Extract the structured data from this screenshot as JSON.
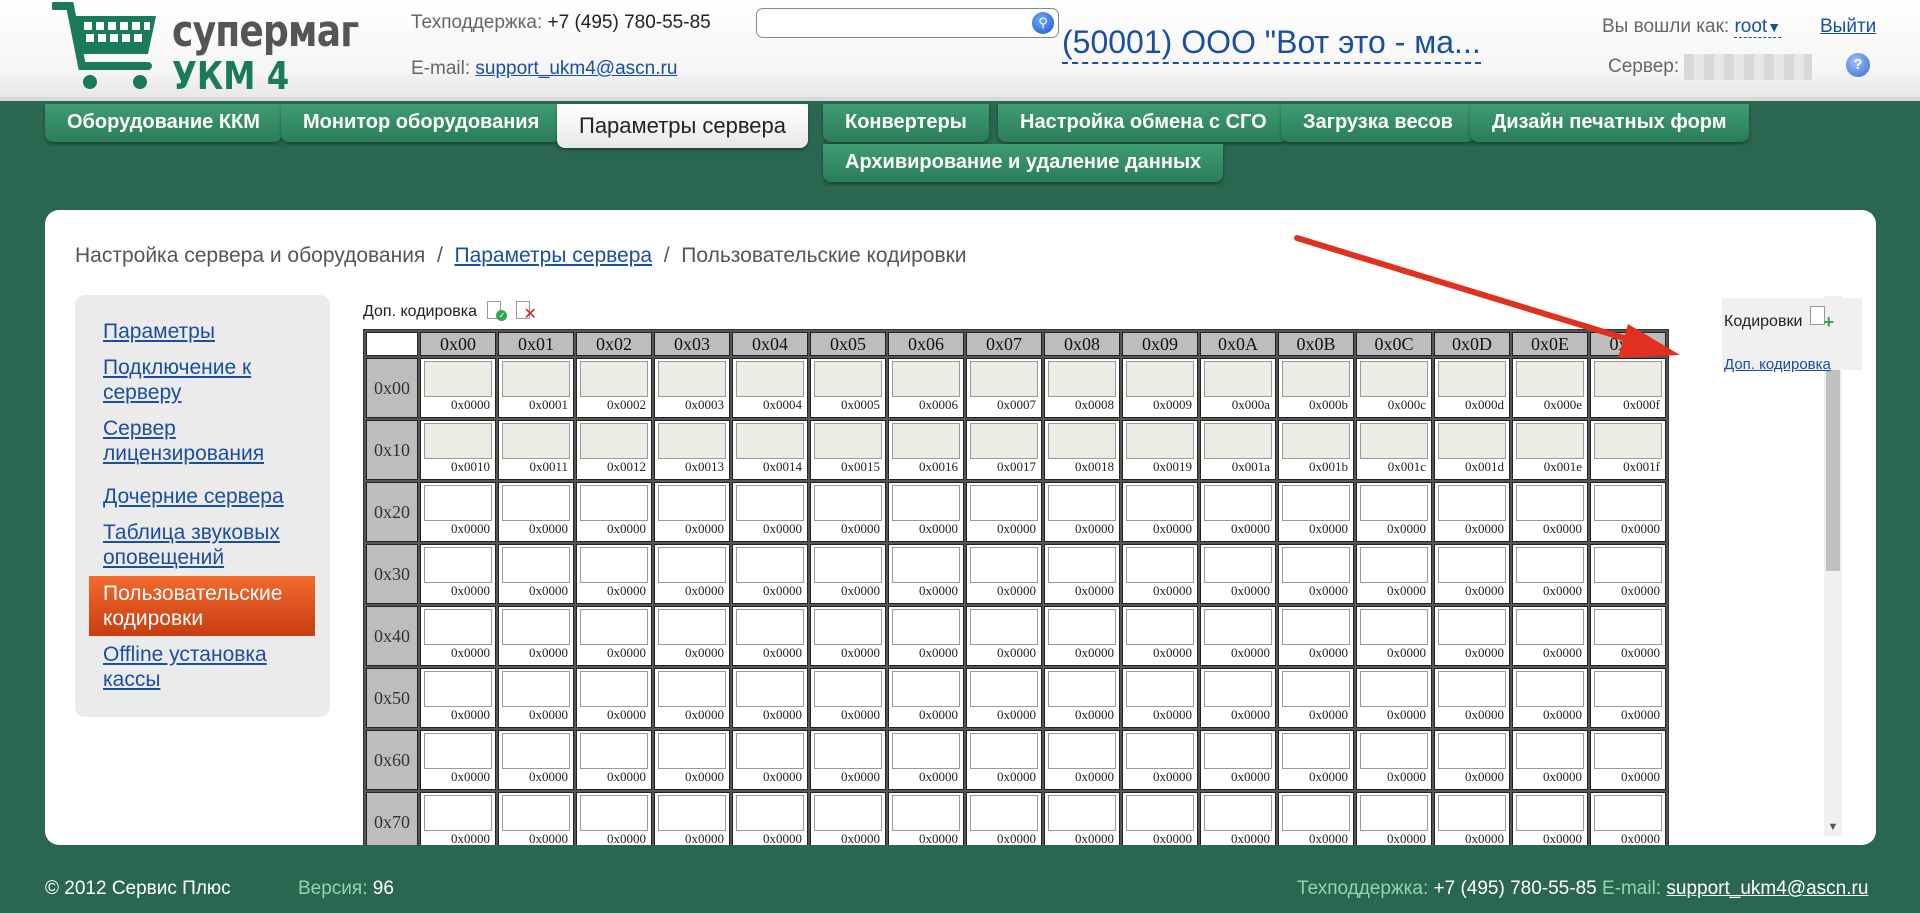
{
  "header": {
    "logo_line1": "супермаг",
    "logo_line2": "УКМ 4",
    "support_label": "Техподдержка:",
    "support_phone": "+7 (495) 780-55-85",
    "email_label": "E-mail:",
    "email": "support_ukm4@ascn.ru",
    "search_value": "",
    "org_name": "(50001) ООО \"Вот это - ма...",
    "user_label": "Вы вошли как:",
    "user": "root",
    "logout": "Выйти",
    "server_label": "Сервер:"
  },
  "tabs": [
    {
      "label": "Оборудование ККМ"
    },
    {
      "label": "Монитор оборудования"
    },
    {
      "label": "Параметры сервера"
    },
    {
      "label": "Конвертеры"
    },
    {
      "label": "Настройка обмена с СГО"
    },
    {
      "label": "Загрузка весов"
    },
    {
      "label": "Дизайн печатных форм"
    },
    {
      "label": "Архивирование и удаление данных"
    }
  ],
  "active_tab": "Параметры сервера",
  "breadcrumb": {
    "root": "Настройка сервера и оборудования",
    "sep": "/",
    "parent": "Параметры сервера",
    "current": "Пользовательские кодировки"
  },
  "sidebar": {
    "items": [
      {
        "label": "Параметры"
      },
      {
        "label": "Подключение к серверу"
      },
      {
        "label": "Сервер лицензирования"
      },
      {
        "label": "Дочерние сервера"
      },
      {
        "label": "Таблица звуковых оповещений"
      },
      {
        "label": "Пользовательские кодировки",
        "active": true
      },
      {
        "label": "Offline установка кассы"
      }
    ]
  },
  "encoding": {
    "title": "Доп. кодировка",
    "col_headers": [
      "0x00",
      "0x01",
      "0x02",
      "0x03",
      "0x04",
      "0x05",
      "0x06",
      "0x07",
      "0x08",
      "0x09",
      "0x0A",
      "0x0B",
      "0x0C",
      "0x0D",
      "0x0E",
      "0x0F"
    ],
    "row_headers": [
      "0x00",
      "0x10",
      "0x20",
      "0x30",
      "0x40",
      "0x50",
      "0x60",
      "0x70"
    ],
    "rows": [
      [
        "0x0000",
        "0x0001",
        "0x0002",
        "0x0003",
        "0x0004",
        "0x0005",
        "0x0006",
        "0x0007",
        "0x0008",
        "0x0009",
        "0x000a",
        "0x000b",
        "0x000c",
        "0x000d",
        "0x000e",
        "0x000f"
      ],
      [
        "0x0010",
        "0x0011",
        "0x0012",
        "0x0013",
        "0x0014",
        "0x0015",
        "0x0016",
        "0x0017",
        "0x0018",
        "0x0019",
        "0x001a",
        "0x001b",
        "0x001c",
        "0x001d",
        "0x001e",
        "0x001f"
      ],
      [
        "0x0000",
        "0x0000",
        "0x0000",
        "0x0000",
        "0x0000",
        "0x0000",
        "0x0000",
        "0x0000",
        "0x0000",
        "0x0000",
        "0x0000",
        "0x0000",
        "0x0000",
        "0x0000",
        "0x0000",
        "0x0000"
      ],
      [
        "0x0000",
        "0x0000",
        "0x0000",
        "0x0000",
        "0x0000",
        "0x0000",
        "0x0000",
        "0x0000",
        "0x0000",
        "0x0000",
        "0x0000",
        "0x0000",
        "0x0000",
        "0x0000",
        "0x0000",
        "0x0000"
      ],
      [
        "0x0000",
        "0x0000",
        "0x0000",
        "0x0000",
        "0x0000",
        "0x0000",
        "0x0000",
        "0x0000",
        "0x0000",
        "0x0000",
        "0x0000",
        "0x0000",
        "0x0000",
        "0x0000",
        "0x0000",
        "0x0000"
      ],
      [
        "0x0000",
        "0x0000",
        "0x0000",
        "0x0000",
        "0x0000",
        "0x0000",
        "0x0000",
        "0x0000",
        "0x0000",
        "0x0000",
        "0x0000",
        "0x0000",
        "0x0000",
        "0x0000",
        "0x0000",
        "0x0000"
      ],
      [
        "0x0000",
        "0x0000",
        "0x0000",
        "0x0000",
        "0x0000",
        "0x0000",
        "0x0000",
        "0x0000",
        "0x0000",
        "0x0000",
        "0x0000",
        "0x0000",
        "0x0000",
        "0x0000",
        "0x0000",
        "0x0000"
      ],
      [
        "0x0000",
        "0x0000",
        "0x0000",
        "0x0000",
        "0x0000",
        "0x0000",
        "0x0000",
        "0x0000",
        "0x0000",
        "0x0000",
        "0x0000",
        "0x0000",
        "0x0000",
        "0x0000",
        "0x0000",
        "0x0000"
      ]
    ],
    "fixed_rows": 2
  },
  "encodings_panel": {
    "title": "Кодировки",
    "items": [
      "Доп. кодировка"
    ]
  },
  "footer": {
    "copyright": "© 2012 Сервис Плюс",
    "version_label": "Версия:",
    "version": "96",
    "support_label": "Техподдержка:",
    "support_phone": "+7 (495) 780-55-85",
    "email_label": "E-mail:",
    "email": "support_ukm4@ascn.ru"
  },
  "colors": {
    "background": "#2b6650",
    "tab": "#3f9c72",
    "link": "#1a4fa0",
    "active_sidebar": "#e8581f",
    "annotation_arrow": "#e03020"
  },
  "icons": [
    "cart-logo-icon",
    "search-icon",
    "dropdown-arrow-icon",
    "help-icon",
    "save-encoding-icon",
    "delete-encoding-icon",
    "add-encoding-icon",
    "scroll-up-icon",
    "scroll-down-icon"
  ]
}
